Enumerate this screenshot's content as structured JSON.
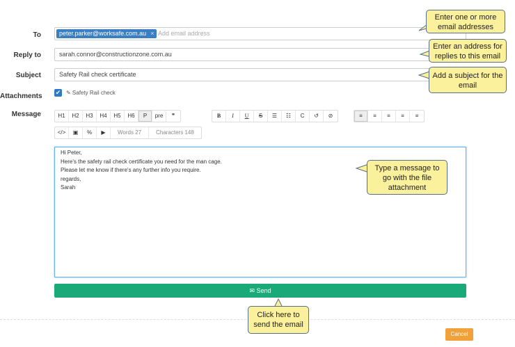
{
  "form": {
    "to_label": "To",
    "to_tag": "peter.parker@worksafe.com.au",
    "to_tag_remove": "×",
    "to_placeholder": "Add email address",
    "reply_label": "Reply to",
    "reply_value": "sarah.connor@constructionzone.com.au",
    "subject_label": "Subject",
    "subject_value": "Safety Rail check certificate",
    "attachments_label": "Attachments",
    "attachment_check": "✔",
    "attachment_name": "✎ Safety Rail check",
    "message_label": "Message"
  },
  "toolbar": {
    "headings": [
      "H1",
      "H2",
      "H3",
      "H4",
      "H5",
      "H6",
      "P",
      "pre",
      "❞"
    ],
    "format": [
      "B",
      "I",
      "U",
      "S",
      "☰",
      "☷",
      "C",
      "↺",
      "⊘"
    ],
    "align": [
      "≡",
      "≡",
      "≡",
      "≡",
      "≡"
    ],
    "insert": [
      "</>",
      "▣",
      "%",
      "▶"
    ],
    "words": "Words 27",
    "characters": "Characters 148"
  },
  "message": {
    "lines": [
      "Hi Peter,",
      "Here's the safety rail check certificate you need for the man cage.",
      "Please let me know if there's any further info you require.",
      "regards,",
      "Sarah"
    ]
  },
  "buttons": {
    "send": "✉ Send",
    "cancel": "Cancel"
  },
  "callouts": {
    "to": "Enter one or more email addresses",
    "reply": "Enter an address for replies to this email",
    "subject": "Add a subject for the email",
    "message": "Type a message to go with the file attachment",
    "send": "Click here to send the email"
  },
  "colors": {
    "accent_blue": "#3a7fc1",
    "send_green": "#1aaa7a",
    "cancel_orange": "#f0a13a",
    "callout_fill": "#fbf09b",
    "callout_border": "#566e86"
  }
}
